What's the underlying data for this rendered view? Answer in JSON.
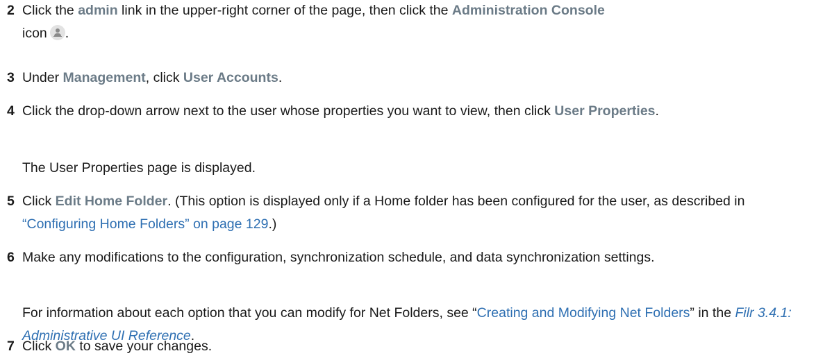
{
  "steps": [
    {
      "num": "2",
      "t1": "Click the ",
      "u1": "admin",
      "t2": " link in the upper-right corner of the page, then click the ",
      "u2": "Administration Console",
      "t3": "icon",
      "t4": "."
    },
    {
      "num": "3",
      "t1": "Under ",
      "u1": "Management",
      "t2": ", click ",
      "u2": "User Accounts",
      "t3": "."
    },
    {
      "num": "4",
      "t1": "Click the drop-down arrow next to the user whose properties you want to view, then click ",
      "u1": "User Properties",
      "t2": "."
    },
    {
      "num": "5",
      "t1": "Click ",
      "u1": "Edit Home Folder",
      "t2": ". (This option is displayed only if a Home folder has been configured for the user, as described in ",
      "link": "“Configuring Home Folders” on page 129",
      "t3": ".)"
    },
    {
      "num": "6",
      "t1": "Make any modifications to the configuration, synchronization schedule, and data synchronization settings."
    },
    {
      "num": "7",
      "t1": "Click ",
      "u1": "OK",
      "t2": " to save your changes."
    }
  ],
  "notes": {
    "displayed": "The User Properties page is displayed.",
    "info_pre": "For information about each option that you can modify for Net Folders, see “",
    "info_link": "Creating and Modifying Net Folders",
    "info_mid": "” in the ",
    "info_book": "Filr 3.4.1: Administrative UI Reference",
    "info_end": "."
  },
  "icons": {
    "admin_console": "administration-console-icon"
  }
}
